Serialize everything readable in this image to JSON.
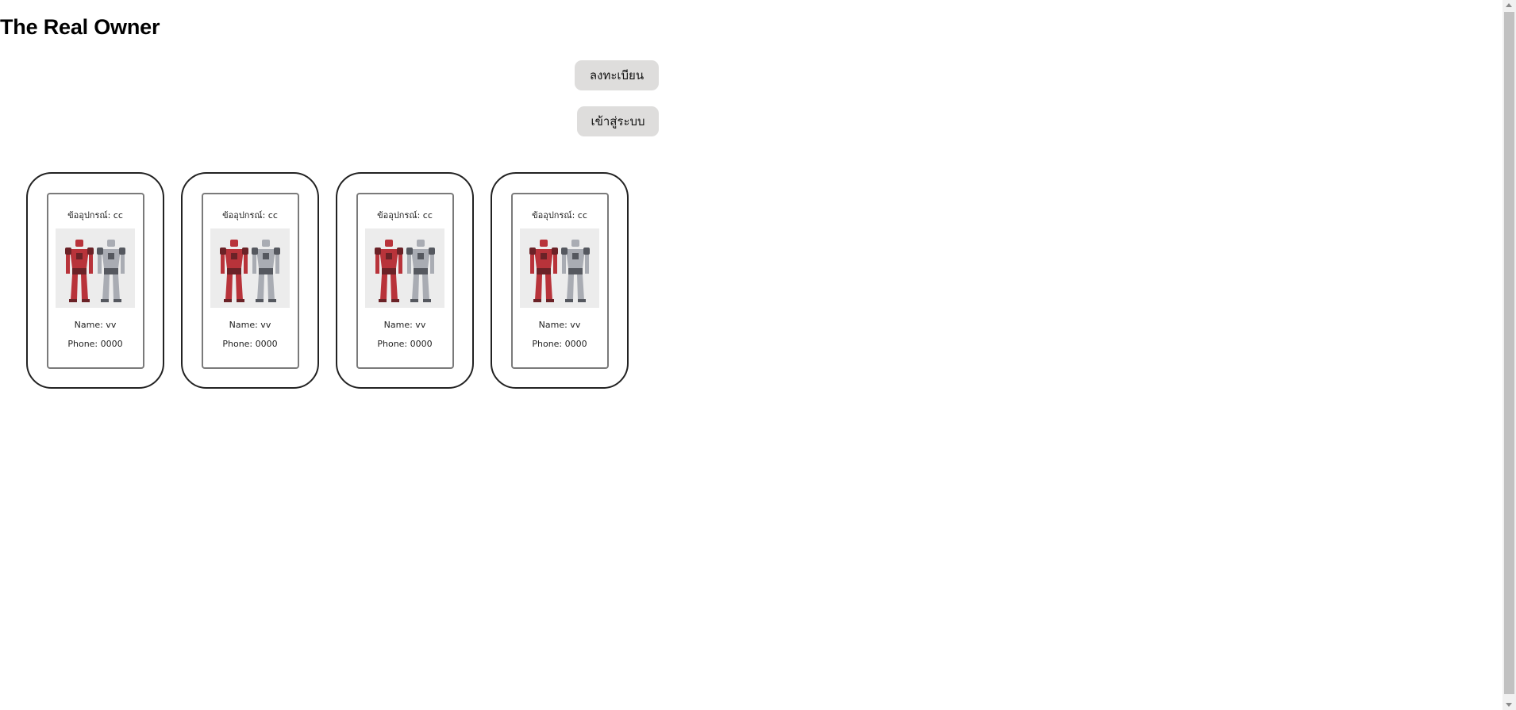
{
  "header": {
    "title": "The Real Owner"
  },
  "actions": {
    "register_label": "ลงทะเบียน",
    "login_label": "เข้าสู่ระบบ"
  },
  "cards": [
    {
      "device_label": "ข้ออุปกรณ์: cc",
      "image_icon": "robot-figures-image",
      "name_label": "Name: vv",
      "phone_label": "Phone: 0000"
    },
    {
      "device_label": "ข้ออุปกรณ์: cc",
      "image_icon": "robot-figures-image",
      "name_label": "Name: vv",
      "phone_label": "Phone: 0000"
    },
    {
      "device_label": "ข้ออุปกรณ์: cc",
      "image_icon": "robot-figures-image",
      "name_label": "Name: vv",
      "phone_label": "Phone: 0000"
    },
    {
      "device_label": "ข้ออุปกรณ์: cc",
      "image_icon": "robot-figures-image",
      "name_label": "Name: vv",
      "phone_label": "Phone: 0000"
    }
  ],
  "colors": {
    "button_bg": "#dedddc",
    "card_border": "#222222",
    "inner_border": "#7a7a7a",
    "robot_red": "#b8333a",
    "robot_gray": "#a9acb3"
  }
}
